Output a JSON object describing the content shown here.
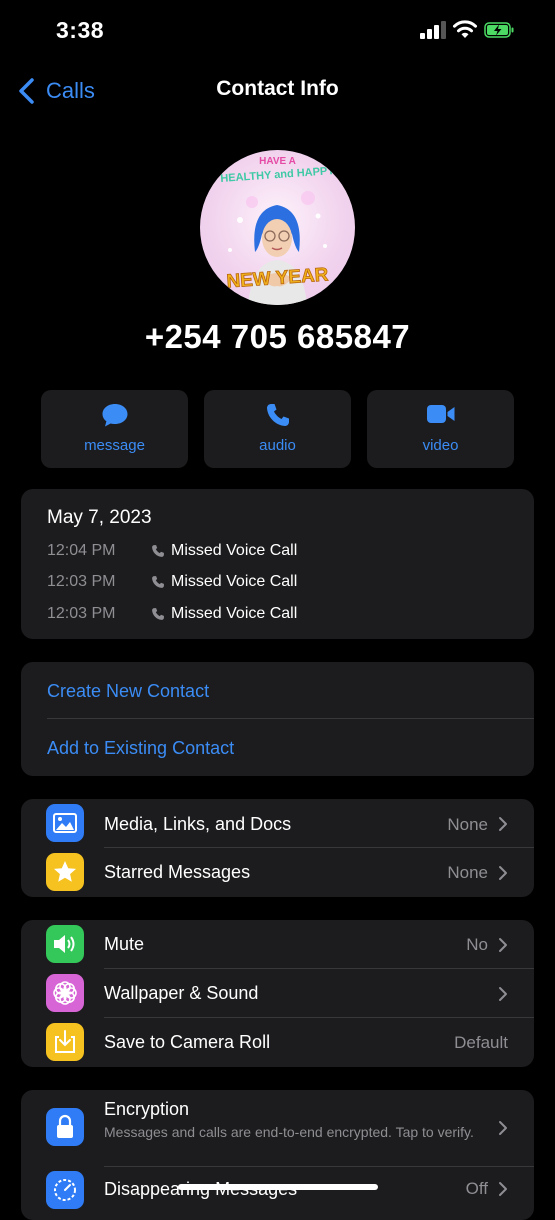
{
  "status_bar": {
    "time": "3:38"
  },
  "nav": {
    "back_label": "Calls",
    "title": "Contact Info"
  },
  "contact": {
    "phone": "+254 705 685847",
    "avatar_text": [
      "HAVE A",
      "HEALTHY and HAPPY",
      "NEW YEAR"
    ]
  },
  "actions": [
    {
      "label": "message",
      "icon": "message-bubble-icon"
    },
    {
      "label": "audio",
      "icon": "phone-icon"
    },
    {
      "label": "video",
      "icon": "video-camera-icon"
    }
  ],
  "call_log": {
    "date": "May 7, 2023",
    "entries": [
      {
        "time": "12:04 PM",
        "desc": "Missed Voice Call"
      },
      {
        "time": "12:03 PM",
        "desc": "Missed Voice Call"
      },
      {
        "time": "12:03 PM",
        "desc": "Missed Voice Call"
      }
    ]
  },
  "contact_actions": {
    "create": "Create New Contact",
    "add_existing": "Add to Existing Contact"
  },
  "section_media": [
    {
      "title": "Media, Links, and Docs",
      "value": "None",
      "icon": "photo-icon",
      "color": "#2f7cf6"
    },
    {
      "title": "Starred Messages",
      "value": "None",
      "icon": "star-icon",
      "color": "#f5c220"
    }
  ],
  "section_settings": [
    {
      "title": "Mute",
      "value": "No",
      "icon": "speaker-icon",
      "color": "#34c759"
    },
    {
      "title": "Wallpaper & Sound",
      "value": "",
      "icon": "flower-icon",
      "color": "#d765d6"
    },
    {
      "title": "Save to Camera Roll",
      "value": "Default",
      "icon": "download-icon",
      "color": "#f5c220"
    }
  ],
  "section_privacy": [
    {
      "title": "Encryption",
      "subtitle": "Messages and calls are end-to-end encrypted. Tap to verify.",
      "icon": "lock-icon",
      "color": "#2f7cf6"
    },
    {
      "title": "Disappearing Messages",
      "value": "Off",
      "icon": "timer-icon",
      "color": "#2f7cf6"
    }
  ],
  "colors": {
    "accent": "#3b8cf5",
    "card": "#1c1c1e",
    "secondary_text": "#8e8e93"
  }
}
